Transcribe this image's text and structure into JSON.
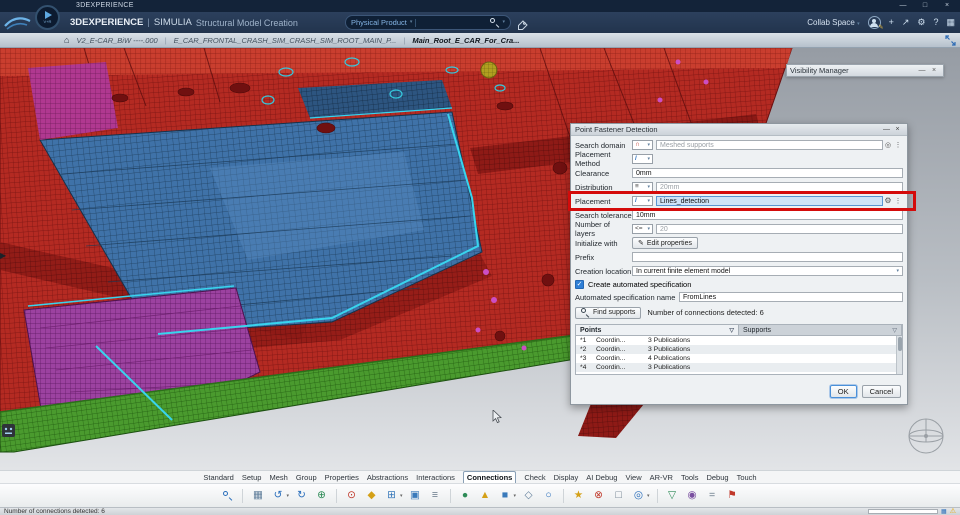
{
  "ui": {
    "caret": "▾",
    "minimize": "—",
    "maximize": "□",
    "close": "×",
    "check": "✓",
    "dots": "⋮",
    "gear": "⚙",
    "reset": "◎",
    "funnel": "▽",
    "home": "⌂",
    "warning": "⚠",
    "plus": "+",
    "help": "?",
    "grid": "▦",
    "share": "↗",
    "pencil": "✎",
    "expander": "▶",
    "separator": "|"
  },
  "titlebar": {
    "app": "3DEXPERIENCE"
  },
  "header": {
    "brand": "3DEXPERIENCE",
    "separator": "|",
    "product": "SIMULIA",
    "app_title": "Structural Model Creation",
    "play_label": "V+R",
    "search_context": "Physical Product",
    "collab": "Collab Space"
  },
  "tabs": {
    "t0": "V2_E-CAR_BiW ----.000",
    "t1": "E_CAR_FRONTAL_CRASH_SIM_CRASH_SIM_ROOT_MAIN_P...",
    "t2": "Main_Root_E_CAR_For_Cra..."
  },
  "visibility_manager": {
    "title": "Visibility Manager"
  },
  "dialog": {
    "title": "Point Fastener Detection",
    "fields": {
      "search_domain": {
        "label": "Search domain",
        "icon": "∩",
        "value": "Meshed supports"
      },
      "placement_method": {
        "label": "Placement Method",
        "icon": "/"
      },
      "clearance": {
        "label": "Clearance",
        "value": "0mm"
      },
      "distribution": {
        "label": "Distribution",
        "icon": "≡",
        "value": "20mm"
      },
      "placement": {
        "label": "Placement",
        "icon": "/",
        "value": "Lines_detection"
      },
      "search_tolerance": {
        "label": "Search tolerance",
        "value": "10mm"
      },
      "number_of_layers": {
        "label": "Number of layers",
        "operator": "<=",
        "value": "20"
      },
      "initialize_with": {
        "label": "Initialize with",
        "button": "Edit properties"
      },
      "prefix": {
        "label": "Prefix",
        "value": ""
      },
      "creation_location": {
        "label": "Creation location",
        "value": "In current finite element model"
      },
      "auto_spec": {
        "label": "Create automated specification",
        "checked": true
      },
      "auto_spec_name": {
        "label": "Automated specification name",
        "value": "FromLines"
      },
      "find_supports": {
        "button": "Find supports",
        "status": "Number of connections detected: 6"
      }
    },
    "results": {
      "tab_points": "Points",
      "tab_supports": "Supports",
      "rows": [
        {
          "id": "*1",
          "name": "Coordin...",
          "info": "3 Publications"
        },
        {
          "id": "*2",
          "name": "Coordin...",
          "info": "3 Publications"
        },
        {
          "id": "*3",
          "name": "Coordin...",
          "info": "4 Publications"
        },
        {
          "id": "*4",
          "name": "Coordin...",
          "info": "3 Publications"
        }
      ]
    },
    "buttons": {
      "ok": "OK",
      "cancel": "Cancel"
    }
  },
  "bottom": {
    "tabs": [
      "Standard",
      "Setup",
      "Mesh",
      "Group",
      "Properties",
      "Abstractions",
      "Interactions",
      "Connections",
      "Check",
      "Display",
      "AI Debug",
      "View",
      "AR-VR",
      "Tools",
      "Debug",
      "Touch"
    ],
    "active": "Connections"
  },
  "toolbar": {
    "icons": [
      {
        "n": "grid",
        "g": "▦",
        "s": "color:#5f7d9a"
      },
      {
        "n": "undo",
        "g": "↺",
        "s": "color:#2a6ebb"
      },
      {
        "n": "redo",
        "g": "↻",
        "s": "color:#2a6ebb"
      },
      {
        "n": "plus-circle",
        "g": "⊕",
        "s": "color:#2e8b57"
      },
      {
        "n": "target",
        "g": "⊙",
        "s": "color:#c0392b"
      },
      {
        "n": "diamond",
        "g": "◆",
        "s": "color:#d4a017"
      },
      {
        "n": "boxed-plus",
        "g": "⊞",
        "s": "color:#3a7abb"
      },
      {
        "n": "filled-square",
        "g": "▣",
        "s": "color:#3a7abb"
      },
      {
        "n": "list",
        "g": "≡",
        "s": "color:#667788"
      },
      {
        "n": "dot",
        "g": "●",
        "s": "color:#2e8b57"
      },
      {
        "n": "triangle-up",
        "g": "▲",
        "s": "color:#d4a017"
      },
      {
        "n": "square",
        "g": "■",
        "s": "color:#3a7abb"
      },
      {
        "n": "diamond-outline",
        "g": "◇",
        "s": "color:#5f7d9a"
      },
      {
        "n": "circle-outline",
        "g": "○",
        "s": "color:#2a6ebb"
      },
      {
        "n": "star",
        "g": "★",
        "s": "color:#d4a017"
      },
      {
        "n": "circled-x",
        "g": "⊗",
        "s": "color:#c0392b"
      },
      {
        "n": "square-outline",
        "g": "□",
        "s": "color:#667788"
      },
      {
        "n": "bullseye",
        "g": "◎",
        "s": "color:#2a6ebb"
      },
      {
        "n": "triangle-down",
        "g": "▽",
        "s": "color:#2e8b57"
      },
      {
        "n": "fisheye",
        "g": "◉",
        "s": "color:#7a4fa0"
      },
      {
        "n": "equals",
        "g": "=",
        "s": "color:#667788"
      },
      {
        "n": "flag",
        "g": "⚑",
        "s": "color:#c0392b"
      }
    ]
  },
  "statusbar": {
    "message": "Number of connections detected: 6"
  },
  "palette": {
    "mesh_red": "#b42a22",
    "mesh_blue": "#3f72a8",
    "mesh_purple": "#9c42a0",
    "mesh_green": "#4a9a2e",
    "highlight_cyan": "#38d4ee",
    "annotation_red": "#d40b0b",
    "selection_blue": "#cfe4f8"
  }
}
